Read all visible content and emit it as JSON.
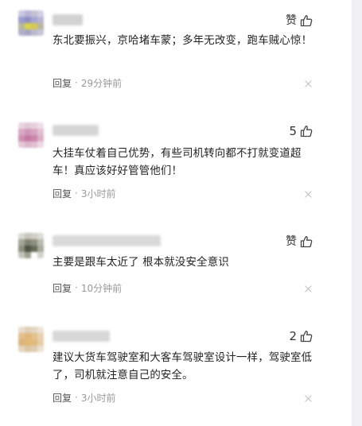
{
  "comments": [
    {
      "like_label": "赞",
      "text": "东北要振兴，京哈堵车蒙；多年无改变，跑车贼心惊！",
      "reply_label": "回复",
      "dot": "·",
      "time": "29分钟前"
    },
    {
      "like_label": "5",
      "text": "大挂车仗着自己优势，有些司机转向都不打就变道超车！真应该好好管管他们！",
      "reply_label": "回复",
      "dot": "·",
      "time": "3小时前"
    },
    {
      "like_label": "赞",
      "text": "主要是跟车太近了 根本就没安全意识",
      "reply_label": "回复",
      "dot": "·",
      "time": "10分钟前"
    },
    {
      "like_label": "2",
      "text": "建议大货车驾驶室和大客车驾驶室设计一样，驾驶室低了，司机就注意自己的安全。",
      "reply_label": "回复",
      "dot": "·",
      "time": "3小时前"
    }
  ],
  "icons": {
    "like": "thumbs-up-icon",
    "dismiss": "close-icon"
  },
  "colors": {
    "text": "#222222",
    "meta": "#999999",
    "scrollbar": "#f1f1f3"
  }
}
